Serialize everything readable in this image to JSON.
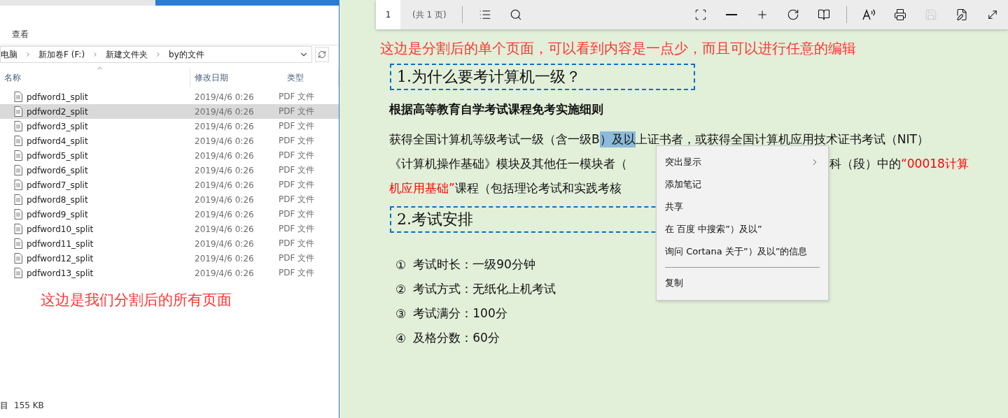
{
  "explorer": {
    "ribbon_tab": "查看",
    "breadcrumbs": [
      "电脑",
      "新加卷F (F:)",
      "新建文件夹",
      "by的文件"
    ],
    "columns": [
      "名称",
      "修改日期",
      "类型"
    ],
    "files": [
      {
        "name": "pdfword1_split",
        "date": "2019/4/6 0:26",
        "type": "PDF 文件",
        "selected": false
      },
      {
        "name": "pdfword2_split",
        "date": "2019/4/6 0:26",
        "type": "PDF 文件",
        "selected": true
      },
      {
        "name": "pdfword3_split",
        "date": "2019/4/6 0:26",
        "type": "PDF 文件",
        "selected": false
      },
      {
        "name": "pdfword4_split",
        "date": "2019/4/6 0:26",
        "type": "PDF 文件",
        "selected": false
      },
      {
        "name": "pdfword5_split",
        "date": "2019/4/6 0:26",
        "type": "PDF 文件",
        "selected": false
      },
      {
        "name": "pdfword6_split",
        "date": "2019/4/6 0:26",
        "type": "PDF 文件",
        "selected": false
      },
      {
        "name": "pdfword7_split",
        "date": "2019/4/6 0:26",
        "type": "PDF 文件",
        "selected": false
      },
      {
        "name": "pdfword8_split",
        "date": "2019/4/6 0:26",
        "type": "PDF 文件",
        "selected": false
      },
      {
        "name": "pdfword9_split",
        "date": "2019/4/6 0:26",
        "type": "PDF 文件",
        "selected": false
      },
      {
        "name": "pdfword10_split",
        "date": "2019/4/6 0:26",
        "type": "PDF 文件",
        "selected": false
      },
      {
        "name": "pdfword11_split",
        "date": "2019/4/6 0:26",
        "type": "PDF 文件",
        "selected": false
      },
      {
        "name": "pdfword12_split",
        "date": "2019/4/6 0:26",
        "type": "PDF 文件",
        "selected": false
      },
      {
        "name": "pdfword13_split",
        "date": "2019/4/6 0:26",
        "type": "PDF 文件",
        "selected": false
      }
    ],
    "annotation": "这边是我们分割后的所有页面",
    "status_bar": {
      "items_label": "目",
      "size": "155 KB"
    }
  },
  "viewer": {
    "toolbar": {
      "page": "1",
      "page_count": "(共 1 页)",
      "left_tools": [
        {
          "kind": "contents",
          "disabled": false
        },
        {
          "kind": "search",
          "disabled": false
        }
      ],
      "view_tools": [
        {
          "kind": "fit",
          "disabled": false
        },
        {
          "kind": "zoom-out",
          "disabled": false
        },
        {
          "kind": "zoom-in",
          "disabled": false
        },
        {
          "kind": "rotate",
          "disabled": false
        },
        {
          "kind": "layout",
          "disabled": false
        }
      ],
      "file_tools": [
        {
          "kind": "read-aloud",
          "disabled": false
        },
        {
          "kind": "print",
          "disabled": false
        },
        {
          "kind": "save",
          "disabled": true
        },
        {
          "kind": "save-as",
          "disabled": false
        },
        {
          "kind": "fullscreen",
          "disabled": false
        }
      ]
    },
    "annotation": "这边是分割后的单个页面，可以看到内容是一点少，而且可以进行任意的编辑",
    "heading_1": "1.为什么要考计算机一级？",
    "subtitle": "根据高等教育自学考试课程免考实施细则",
    "paragraph_lines": [
      {
        "left": [
          {
            "text": "获得全国计算机等级考试一级（含一级B",
            "red": false,
            "selected": false
          },
          {
            "text": "）及以",
            "red": false,
            "selected": true
          },
          {
            "text": "上证书者，或获得全国计算机应用技术证书考试（NIT）",
            "red": false,
            "selected": false
          }
        ]
      },
      {
        "left": [
          {
            "text": "《计算机操作基础》模块及其他任一模块者（",
            "red": false,
            "selected": false
          }
        ],
        "right": [
          {
            "text": "科（段）中的",
            "red": false,
            "selected": false
          },
          {
            "text": "“00018计算",
            "red": true,
            "selected": false
          }
        ]
      },
      {
        "left": [
          {
            "text": "机应用基础”",
            "red": true,
            "selected": false
          },
          {
            "text": "课程（包括理论考试和实践考核",
            "red": false,
            "selected": false
          }
        ]
      }
    ],
    "heading_2": "2.考试安排",
    "list": [
      {
        "marker": "①",
        "text": "考试时长：一级90分钟"
      },
      {
        "marker": "②",
        "text": "考试方式：无纸化上机考试"
      },
      {
        "marker": "③",
        "text": "考试满分：100分"
      },
      {
        "marker": "④",
        "text": "及格分数：60分"
      }
    ],
    "context_menu": [
      {
        "kind": "submenu",
        "label": "突出显示"
      },
      {
        "kind": "item",
        "label": "添加笔记"
      },
      {
        "kind": "item",
        "label": "共享"
      },
      {
        "kind": "item",
        "label": "在 百度 中搜索”）及以”"
      },
      {
        "kind": "item",
        "label": "询问 Cortana 关于”）及以”的信息"
      },
      {
        "kind": "separator"
      },
      {
        "kind": "item",
        "label": "复制"
      }
    ]
  }
}
